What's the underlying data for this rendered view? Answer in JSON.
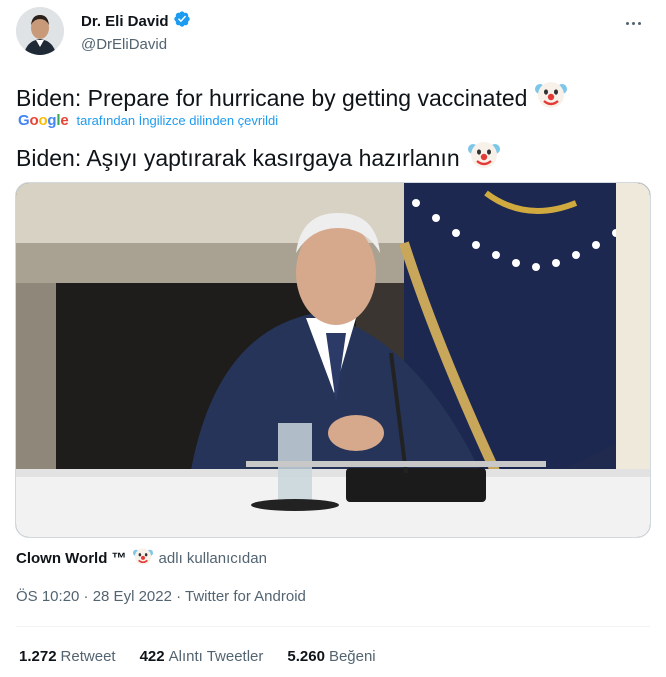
{
  "author": {
    "display_name": "Dr. Eli David",
    "handle": "@DrEliDavid",
    "verified_icon": "verified-badge-icon",
    "avatar": "avatar"
  },
  "tweet": {
    "text": "Biden: Prepare for hurricane by getting vaccinated",
    "emoji": "clown-face",
    "translation_brand": "Google",
    "translation_note": "tarafından İngilizce dilinden çevrildi",
    "translated_text": "Biden: Aşıyı yaptırarak kasırgaya hazırlanın"
  },
  "media": {
    "description": "video-frame"
  },
  "source": {
    "name": "Clown World ™",
    "suffix": "adlı kullanıcıdan"
  },
  "meta": {
    "timestamp_line": "ÖS 10:20 · 28 Eyl 2022 · Twitter for Android"
  },
  "stats": [
    {
      "num": "1.272",
      "label": "Retweet"
    },
    {
      "num": "422",
      "label": "Alıntı Tweetler"
    },
    {
      "num": "5.260",
      "label": "Beğeni"
    }
  ],
  "colors": {
    "accent": "#1d9bf0",
    "text": "#0f1419",
    "secondary": "#536471"
  }
}
